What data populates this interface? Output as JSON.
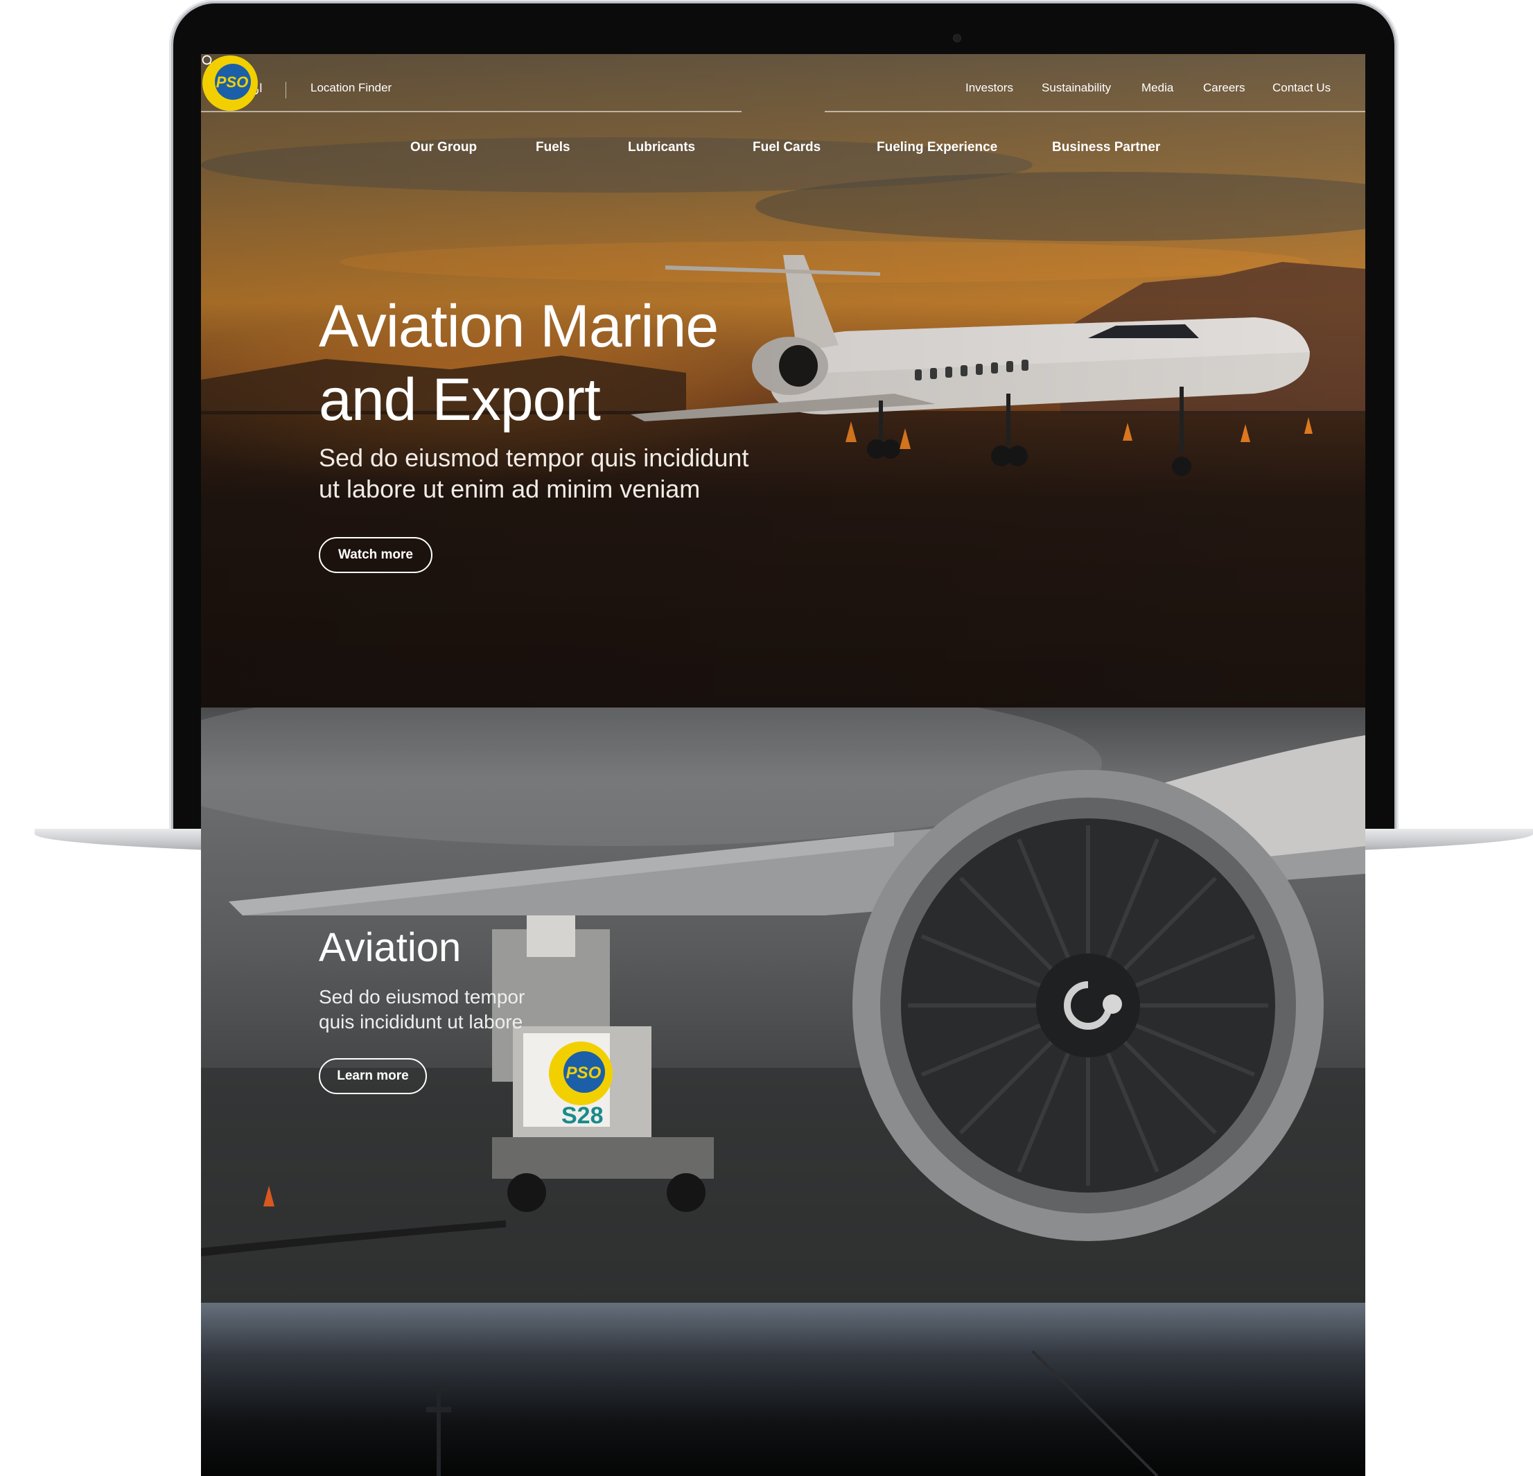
{
  "header": {
    "urdu_label": "اردو",
    "location_finder": "Location Finder",
    "utility_nav": [
      "Investors",
      "Sustainability",
      "Media",
      "Careers",
      "Contact Us"
    ],
    "logo_text": "PSO",
    "main_nav": [
      "Our Group",
      "Fuels",
      "Lubricants",
      "Fuel Cards",
      "Fueling Experience",
      "Business Partner"
    ]
  },
  "hero": {
    "title_line1": "Aviation Marine",
    "title_line2": "and Export",
    "subtitle_line1": "Sed do eiusmod tempor quis incididunt",
    "subtitle_line2": "ut labore ut enim ad minim veniam",
    "button": "Watch more"
  },
  "aviation": {
    "title": "Aviation",
    "subtitle_line1": "Sed do eiusmod tempor",
    "subtitle_line2": "quis incididunt ut labore",
    "button": "Learn more",
    "truck_label": "S28"
  },
  "colors": {
    "brand_green": "#1a9e3c",
    "brand_blue": "#1b5fa8",
    "brand_yellow": "#f2d000"
  }
}
